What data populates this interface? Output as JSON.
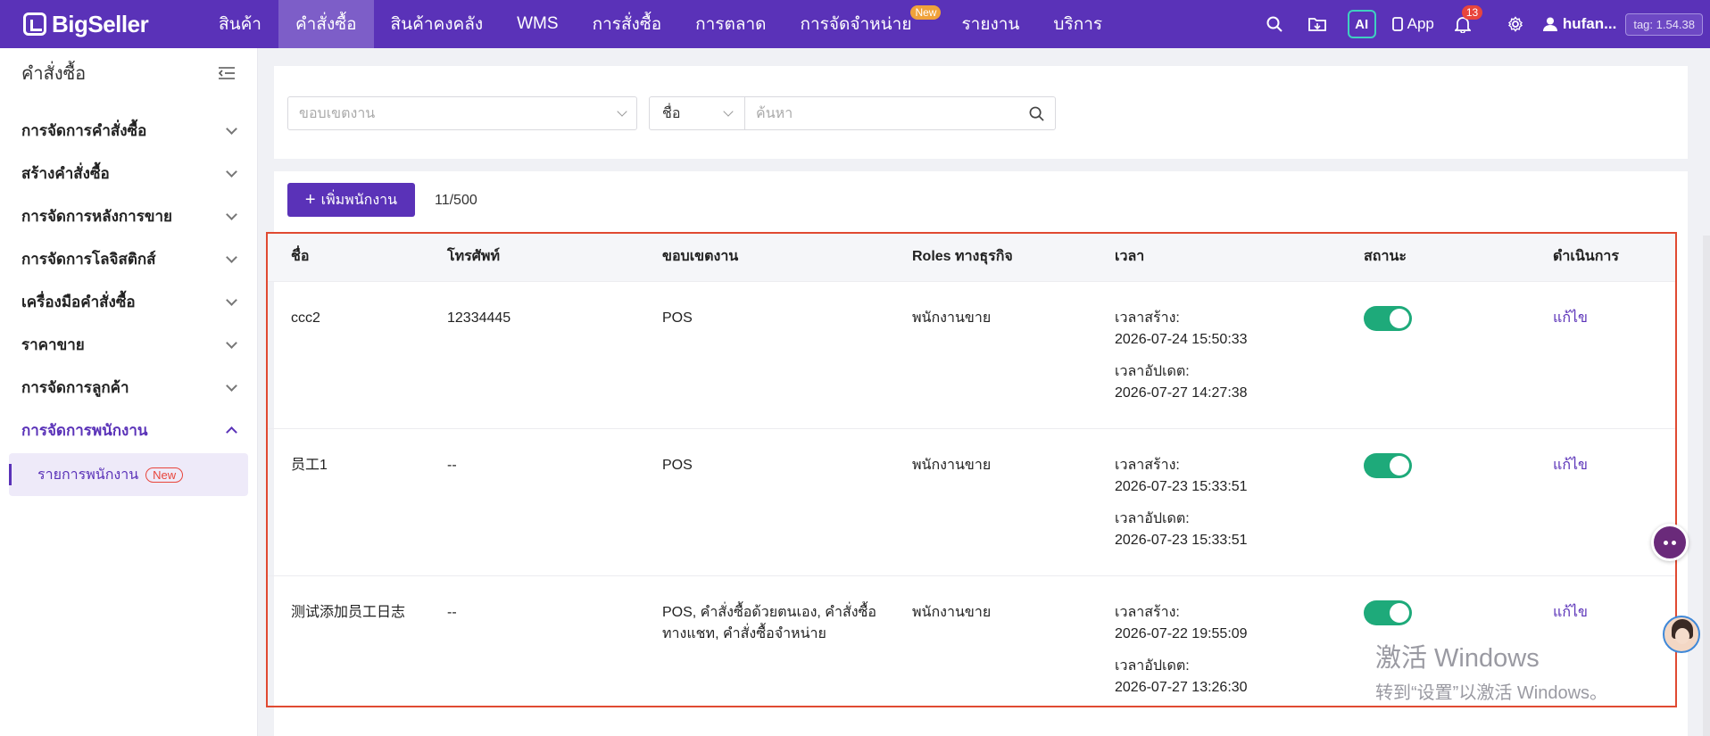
{
  "brand": {
    "name": "BigSeller"
  },
  "nav": {
    "items": [
      {
        "label": "สินค้า"
      },
      {
        "label": "คำสั่งซื้อ",
        "active": true
      },
      {
        "label": "สินค้าคงคลัง"
      },
      {
        "label": "WMS"
      },
      {
        "label": "การสั่งซื้อ"
      },
      {
        "label": "การตลาด"
      },
      {
        "label": "การจัดจำหน่าย",
        "badge": "New"
      },
      {
        "label": "รายงาน"
      },
      {
        "label": "บริการ"
      }
    ],
    "right": {
      "ai_label": "AI",
      "app_label": "App",
      "notification_count": "13",
      "user_name": "hufan...",
      "version_tag": "tag: 1.54.38"
    }
  },
  "sidebar": {
    "title": "คำสั่งซื้อ",
    "items": [
      {
        "label": "การจัดการคำสั่งซื้อ"
      },
      {
        "label": "สร้างคำสั่งซื้อ"
      },
      {
        "label": "การจัดการหลังการขาย"
      },
      {
        "label": "การจัดการโลจิสติกส์"
      },
      {
        "label": "เครื่องมือคำสั่งซื้อ"
      },
      {
        "label": "ราคาขาย"
      },
      {
        "label": "การจัดการลูกค้า"
      },
      {
        "label": "การจัดการพนักงาน",
        "expanded": true
      }
    ],
    "sub_item": {
      "label": "รายการพนักงาน",
      "badge": "New"
    }
  },
  "filters": {
    "scope_placeholder": "ขอบเขตงาน",
    "search_field": "ชื่อ",
    "search_placeholder": "ค้นหา"
  },
  "toolbar": {
    "add_label": "เพิ่มพนักงาน",
    "count": "11/500"
  },
  "table": {
    "headers": [
      "ชื่อ",
      "โทรศัพท์",
      "ขอบเขตงาน",
      "Roles ทางธุรกิจ",
      "เวลา",
      "สถานะ",
      "ดำเนินการ"
    ],
    "created_label": "เวลาสร้าง:",
    "updated_label": "เวลาอัปเดต:",
    "edit_label": "แก้ไข",
    "rows": [
      {
        "name": "ccc2",
        "phone": "12334445",
        "scope": "POS",
        "role": "พนักงานขาย",
        "created": "2026-07-24 15:50:33",
        "updated": "2026-07-27 14:27:38",
        "status_on": true
      },
      {
        "name": "员工1",
        "phone": "--",
        "scope": "POS",
        "role": "พนักงานขาย",
        "created": "2026-07-23 15:33:51",
        "updated": "2026-07-23 15:33:51",
        "status_on": true
      },
      {
        "name": "测试添加员工日志",
        "phone": "--",
        "scope": "POS, คำสั่งซื้อด้วยตนเอง, คำสั่งซื้อทางแชท, คำสั่งซื้อจำหน่าย",
        "role": "พนักงานขาย",
        "created": "2026-07-22 19:55:09",
        "updated": "2026-07-27 13:26:30",
        "status_on": true
      }
    ]
  },
  "watermark": {
    "line1": "激活 Windows",
    "line2": "转到“设置”以激活 Windows。"
  },
  "colors": {
    "brand": "#5a32b8",
    "toggle_on": "#1eaa7a",
    "highlight_frame": "#e04a32"
  }
}
